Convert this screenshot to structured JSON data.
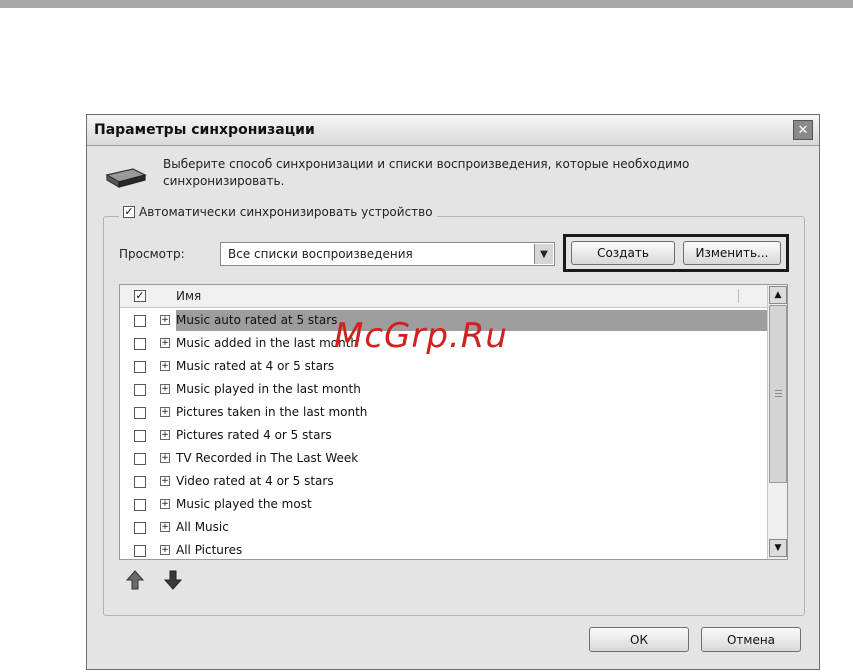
{
  "dialog": {
    "title": "Параметры синхронизации",
    "close_glyph": "✕",
    "description": "Выберите способ синхронизации и списки воспроизведения, которые необходимо синхронизировать.",
    "auto_sync": {
      "label": "Автоматически синхронизировать устройство",
      "checked": true
    },
    "view": {
      "label": "Просмотр:",
      "selected": "Все списки воспроизведения"
    },
    "create_label": "Создать",
    "edit_label": "Изменить...",
    "list": {
      "column_name": "Имя",
      "header_checked": true,
      "items": [
        {
          "label": "Music auto rated at 5 stars",
          "checked": false,
          "selected": true
        },
        {
          "label": "Music added in the last month",
          "checked": false,
          "selected": false
        },
        {
          "label": "Music rated at 4 or 5 stars",
          "checked": false,
          "selected": false
        },
        {
          "label": "Music played in the last month",
          "checked": false,
          "selected": false
        },
        {
          "label": "Pictures taken in the last month",
          "checked": false,
          "selected": false
        },
        {
          "label": "Pictures rated 4 or 5 stars",
          "checked": false,
          "selected": false
        },
        {
          "label": "TV Recorded in The Last Week",
          "checked": false,
          "selected": false
        },
        {
          "label": "Video rated at 4 or 5 stars",
          "checked": false,
          "selected": false
        },
        {
          "label": "Music played the most",
          "checked": false,
          "selected": false
        },
        {
          "label": "All Music",
          "checked": false,
          "selected": false
        },
        {
          "label": "All Pictures",
          "checked": false,
          "selected": false
        }
      ]
    },
    "ok_label": "ОК",
    "cancel_label": "Отмена"
  },
  "watermark": "McGrp.Ru",
  "icons": {
    "close": "close-icon",
    "device": "device-icon",
    "move_up": "arrow-up-icon",
    "move_down": "arrow-down-icon",
    "expand": "plus-box-icon",
    "dropdown": "chevron-down-icon"
  },
  "colors": {
    "dialog_bg": "#e4e4e4",
    "selected_row": "#9d9d9d",
    "watermark": "#d22020",
    "highlight_border": "#1a1a1a"
  }
}
